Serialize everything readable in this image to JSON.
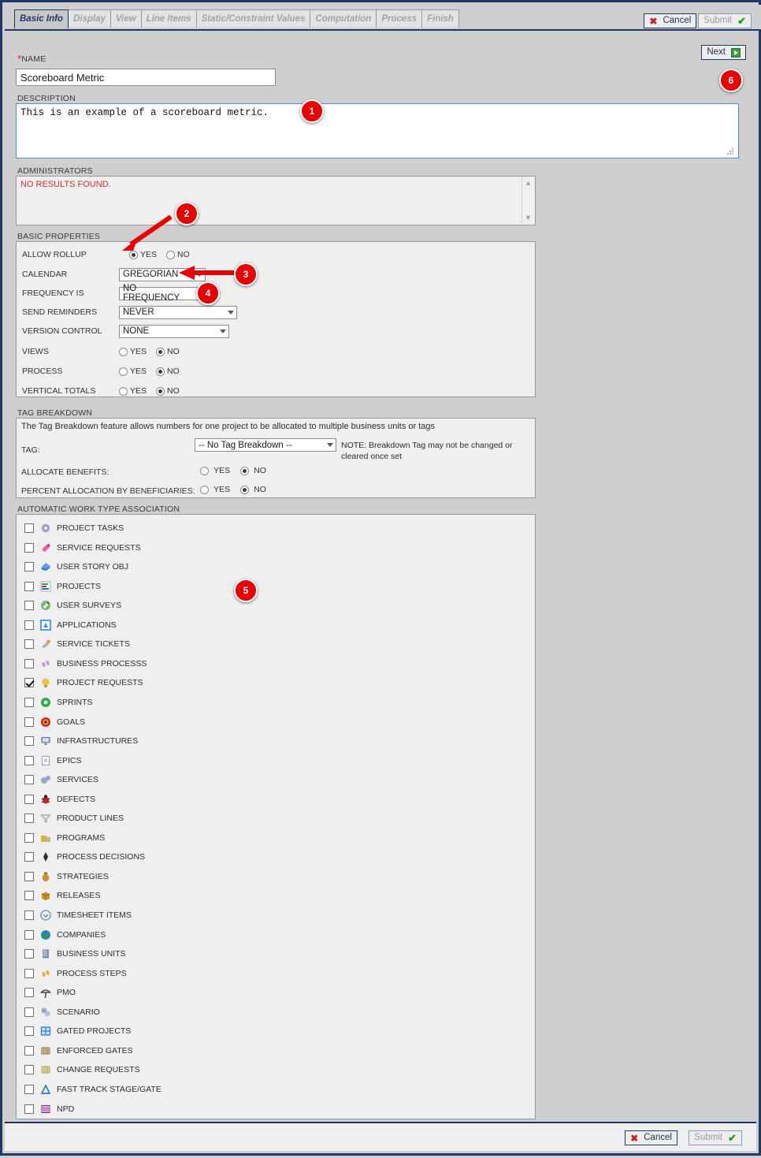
{
  "tabs": [
    {
      "label": "Basic Info",
      "active": true
    },
    {
      "label": "Display",
      "active": false
    },
    {
      "label": "View",
      "active": false
    },
    {
      "label": "Line Items",
      "active": false
    },
    {
      "label": "Static/Constraint Values",
      "active": false
    },
    {
      "label": "Computation",
      "active": false
    },
    {
      "label": "Process",
      "active": false
    },
    {
      "label": "Finish",
      "active": false
    }
  ],
  "toolbar": {
    "cancel_label": "Cancel",
    "submit_label": "Submit",
    "next_label": "Next"
  },
  "footer": {
    "cancel_label": "Cancel",
    "submit_label": "Submit"
  },
  "name_field": {
    "label": "NAME",
    "required_marker": "*",
    "value": "Scoreboard Metric"
  },
  "description_field": {
    "label": "DESCRIPTION",
    "value": "This is an example of a scoreboard metric."
  },
  "administrators": {
    "label": "ADMINISTRATORS",
    "empty_message": "NO RESULTS FOUND."
  },
  "basic_properties": {
    "label": "BASIC PROPERTIES",
    "rows": [
      {
        "name": "ALLOW ROLLUP",
        "type": "radio",
        "yes_label": "YES",
        "no_label": "NO",
        "selected": "YES"
      },
      {
        "name": "CALENDAR",
        "type": "select",
        "value": "GREGORIAN"
      },
      {
        "name": "FREQUENCY IS",
        "type": "select",
        "value": "NO FREQUENCY"
      },
      {
        "name": "SEND REMINDERS",
        "type": "select",
        "value": "NEVER"
      },
      {
        "name": "VERSION CONTROL",
        "type": "select",
        "value": "NONE"
      },
      {
        "name": "VIEWS",
        "type": "radio",
        "yes_label": "YES",
        "no_label": "NO",
        "selected": "NO"
      },
      {
        "name": "PROCESS",
        "type": "radio",
        "yes_label": "YES",
        "no_label": "NO",
        "selected": "NO"
      },
      {
        "name": "VERTICAL TOTALS",
        "type": "radio",
        "yes_label": "YES",
        "no_label": "NO",
        "selected": "NO"
      }
    ]
  },
  "tag_breakdown": {
    "label": "TAG BREAKDOWN",
    "description": "The Tag Breakdown feature allows numbers for one project to be allocated to multiple business units or tags",
    "tag_label": "TAG:",
    "tag_value": "-- No Tag Breakdown --",
    "note": "NOTE: Breakdown Tag may not be changed or cleared once set",
    "allocate_benefits_label": "ALLOCATE BENEFITS:",
    "allocate_benefits_selected": "NO",
    "percent_allocation_label": "PERCENT ALLOCATION BY BENEFICIARIES:",
    "percent_allocation_selected": "NO",
    "yes_label": "YES",
    "no_label": "NO"
  },
  "work_types": {
    "label": "AUTOMATIC WORK TYPE ASSOCIATION",
    "items": [
      {
        "label": "PROJECT TASKS",
        "checked": false,
        "icon": "gear-icon",
        "color": "#9aa3c8"
      },
      {
        "label": "SERVICE REQUESTS",
        "checked": false,
        "icon": "service-request-icon",
        "color": "#e8609a"
      },
      {
        "label": "USER STORY OBJ",
        "checked": false,
        "icon": "book-icon",
        "color": "#2f6fd0"
      },
      {
        "label": "PROJECTS",
        "checked": false,
        "icon": "gantt-icon",
        "color": "#3f9b5f"
      },
      {
        "label": "USER SURVEYS",
        "checked": false,
        "icon": "survey-icon",
        "color": "#7ab87a"
      },
      {
        "label": "APPLICATIONS",
        "checked": false,
        "icon": "application-icon",
        "color": "#2e8ad6"
      },
      {
        "label": "SERVICE TICKETS",
        "checked": false,
        "icon": "ticket-icon",
        "color": "#c8a24a"
      },
      {
        "label": "BUSINESS PROCESSS",
        "checked": false,
        "icon": "footsteps-icon",
        "color": "#c49ad8"
      },
      {
        "label": "PROJECT REQUESTS",
        "checked": true,
        "icon": "lightbulb-icon",
        "color": "#e8c53a"
      },
      {
        "label": "SPRINTS",
        "checked": false,
        "icon": "recycle-icon",
        "color": "#2fa84f"
      },
      {
        "label": "GOALS",
        "checked": false,
        "icon": "target-icon",
        "color": "#d42020"
      },
      {
        "label": "INFRASTRUCTURES",
        "checked": false,
        "icon": "monitor-icon",
        "color": "#6878a8"
      },
      {
        "label": "EPICS",
        "checked": false,
        "icon": "document-icon",
        "color": "#9aa8c0"
      },
      {
        "label": "SERVICES",
        "checked": false,
        "icon": "gears-icon",
        "color": "#9aa3c8"
      },
      {
        "label": "DEFECTS",
        "checked": false,
        "icon": "bug-icon",
        "color": "#c62020"
      },
      {
        "label": "PRODUCT LINES",
        "checked": false,
        "icon": "funnel-icon",
        "color": "#9a9a9a"
      },
      {
        "label": "PROGRAMS",
        "checked": false,
        "icon": "program-icon",
        "color": "#d8b43a"
      },
      {
        "label": "PROCESS DECISIONS",
        "checked": false,
        "icon": "diamond-icon",
        "color": "#2b2b2b"
      },
      {
        "label": "STRATEGIES",
        "checked": false,
        "icon": "moneybag-icon",
        "color": "#c8912a"
      },
      {
        "label": "RELEASES",
        "checked": false,
        "icon": "package-icon",
        "color": "#c8922a"
      },
      {
        "label": "TIMESHEET ITEMS",
        "checked": false,
        "icon": "clock-chevron-icon",
        "color": "#7f98b8"
      },
      {
        "label": "COMPANIES",
        "checked": false,
        "icon": "globe-icon",
        "color": "#2f9b45"
      },
      {
        "label": "BUSINESS UNITS",
        "checked": false,
        "icon": "building-icon",
        "color": "#7f94a8"
      },
      {
        "label": "PROCESS STEPS",
        "checked": false,
        "icon": "footsteps-icon",
        "color": "#d8b43a"
      },
      {
        "label": "PMO",
        "checked": false,
        "icon": "umbrella-icon",
        "color": "#2b2b2b"
      },
      {
        "label": "SCENARIO",
        "checked": false,
        "icon": "scenario-icon",
        "color": "#9aa3c8"
      },
      {
        "label": "GATED PROJECTS",
        "checked": false,
        "icon": "gate-icon",
        "color": "#2e7ad6"
      },
      {
        "label": "ENFORCED GATES",
        "checked": false,
        "icon": "fence-icon",
        "color": "#8a7048"
      },
      {
        "label": "CHANGE REQUESTS",
        "checked": false,
        "icon": "fence-icon",
        "color": "#a8a84a"
      },
      {
        "label": "FAST TRACK STAGE/GATE",
        "checked": false,
        "icon": "triangle-icon",
        "color": "#2e7ad6"
      },
      {
        "label": "NPD",
        "checked": false,
        "icon": "barcode-icon",
        "color": "#c22ac2"
      }
    ]
  },
  "callouts": [
    {
      "number": "1"
    },
    {
      "number": "2"
    },
    {
      "number": "3"
    },
    {
      "number": "4"
    },
    {
      "number": "5"
    },
    {
      "number": "6"
    }
  ],
  "colors": {
    "accent": "#1f3864",
    "badge": "#e60000",
    "required": "#e02020",
    "error_text": "#d32f2f"
  }
}
